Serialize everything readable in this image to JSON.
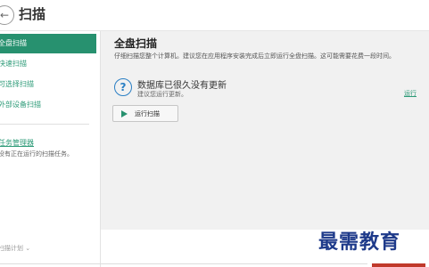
{
  "header": {
    "back_icon": "back-arrow-icon",
    "title": "扫描"
  },
  "sidebar": {
    "items": [
      {
        "label": "全盘扫描",
        "active": true
      },
      {
        "label": "快速扫描",
        "active": false
      },
      {
        "label": "可选择扫描",
        "active": false
      },
      {
        "label": "外部设备扫描",
        "active": false
      }
    ],
    "task_manager_link": "任务管理器",
    "task_status": "没有正在运行的扫描任务。",
    "schedule_link": "扫描计划 ⌄"
  },
  "main": {
    "title": "全盘扫描",
    "description": "仔细扫描您整个计算机。建议您在应用程序安装完成后立即运行全盘扫描。这可能需要花费一段时间。",
    "notice_icon": "question-icon",
    "notice_title": "数据库已很久没有更新",
    "notice_sub": "建议您运行更新。",
    "notice_link": "运行",
    "run_button_label": "运行扫描"
  },
  "watermark": "最需教育",
  "colors": {
    "accent": "#27916f",
    "link": "#2e9b78",
    "info_blue": "#2a7fc4"
  }
}
